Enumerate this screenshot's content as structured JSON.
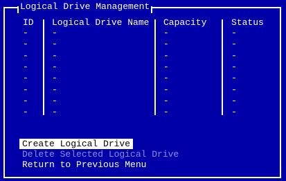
{
  "window": {
    "title": "Logical Drive Management"
  },
  "table": {
    "columns": [
      "ID",
      "Logical Drive Name",
      "Capacity",
      "Status"
    ],
    "rows": [
      [
        "-",
        "-",
        "-",
        "-"
      ],
      [
        "-",
        "-",
        "-",
        "-"
      ],
      [
        "-",
        "-",
        "-",
        "-"
      ],
      [
        "-",
        "-",
        "-",
        "-"
      ],
      [
        "-",
        "-",
        "-",
        "-"
      ],
      [
        "-",
        "-",
        "-",
        "-"
      ],
      [
        "-",
        "-",
        "-",
        "-"
      ],
      [
        "-",
        "-",
        "-",
        "-"
      ]
    ]
  },
  "menu": {
    "items": [
      {
        "label": "Create Logical Drive",
        "state": "selected"
      },
      {
        "label": "Delete Selected Logical Drive",
        "state": "disabled"
      },
      {
        "label": "Return to Previous Menu",
        "state": "normal"
      }
    ]
  },
  "colors": {
    "background": "#0000a8",
    "text": "#ffffff",
    "disabled": "#8c8cf0",
    "highlight": "#ffffff"
  }
}
